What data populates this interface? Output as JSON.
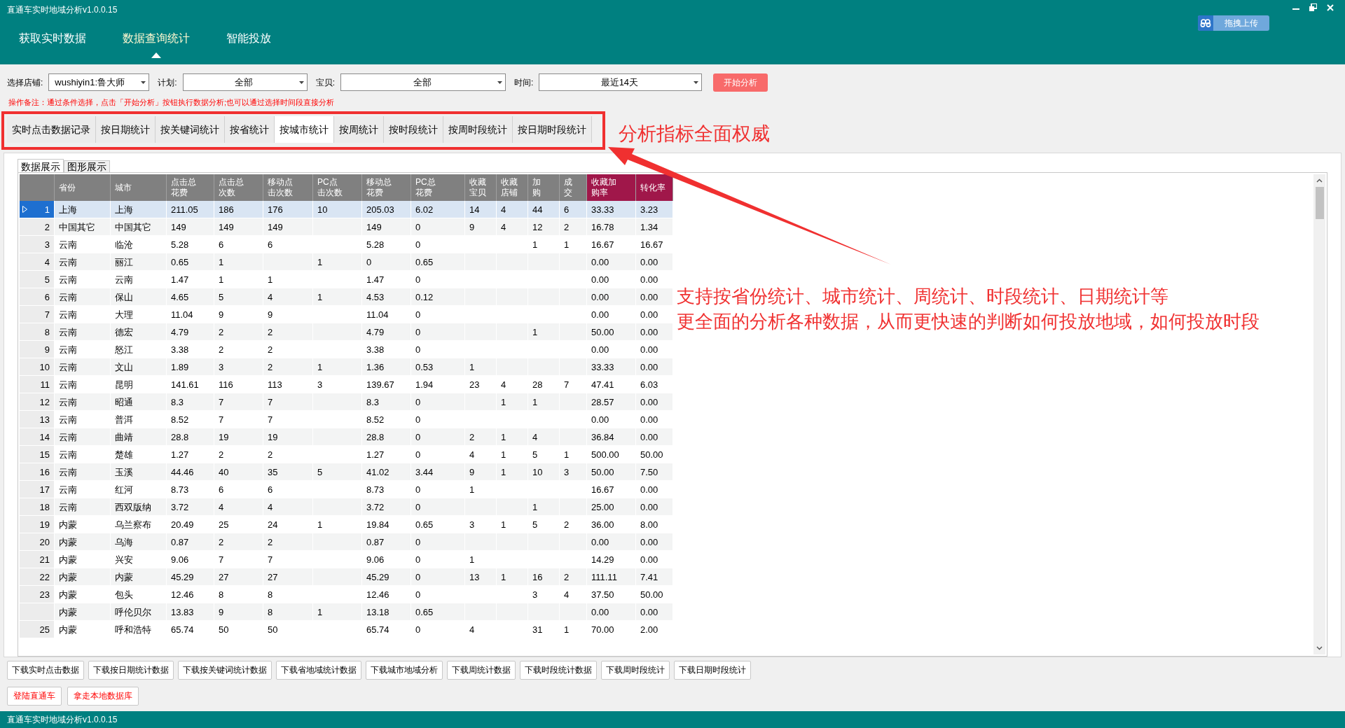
{
  "window": {
    "title": "直通车实时地域分析v1.0.0.15"
  },
  "nav_tabs": [
    {
      "label": "获取实时数据",
      "selected": false
    },
    {
      "label": "数据查询统计",
      "selected": true
    },
    {
      "label": "智能投放",
      "selected": false
    }
  ],
  "upload_button": {
    "label": "拖拽上传"
  },
  "filters": [
    {
      "label": "选择店铺:",
      "value": "wushiyin1:鲁大师"
    },
    {
      "label": "计划:",
      "value": "全部"
    },
    {
      "label": "宝贝:",
      "value": "全部"
    },
    {
      "label": "时间:",
      "value": "最近14天"
    }
  ],
  "analyze_button": {
    "label": "开始分析"
  },
  "note": "操作备注：通过条件选择，点击「开始分析」按钮执行数据分析;也可以通过选择时间段直接分析",
  "tabs": [
    {
      "label": "实时点击数据记录",
      "selected": false
    },
    {
      "label": "按日期统计",
      "selected": false
    },
    {
      "label": "按关键词统计",
      "selected": false
    },
    {
      "label": "按省统计",
      "selected": false
    },
    {
      "label": "按城市统计",
      "selected": true
    },
    {
      "label": "按周统计",
      "selected": false
    },
    {
      "label": "按时段统计",
      "selected": false
    },
    {
      "label": "按周时段统计",
      "selected": false
    },
    {
      "label": "按日期时段统计",
      "selected": false
    }
  ],
  "annotation_title": "分析指标全面权威",
  "annotation_lines": [
    "支持按省份统计、城市统计、周统计、时段统计、日期统计等",
    "更全面的分析各种数据，从而更快速的判断如何投放地域，如何投放时段"
  ],
  "view_tabs": [
    {
      "label": "数据展示",
      "selected": true
    },
    {
      "label": "图形展示",
      "selected": false
    }
  ],
  "table": {
    "columns": [
      {
        "label": "省份",
        "color": "#808080"
      },
      {
        "label": "城市",
        "color": "#808080"
      },
      {
        "label": "点击总花费",
        "color": "#808080"
      },
      {
        "label": "点击总次数",
        "color": "#808080"
      },
      {
        "label": "移动点击次数",
        "color": "#808080"
      },
      {
        "label": "PC点击次数",
        "color": "#808080"
      },
      {
        "label": "移动总花费",
        "color": "#808080"
      },
      {
        "label": "PC总花费",
        "color": "#808080"
      },
      {
        "label": "收藏宝贝",
        "color": "#808080"
      },
      {
        "label": "收藏店铺",
        "color": "#808080"
      },
      {
        "label": "加购",
        "color": "#808080"
      },
      {
        "label": "成交",
        "color": "#808080"
      },
      {
        "label": "收藏加购率",
        "color": "#a0174a"
      },
      {
        "label": "转化率",
        "color": "#a0174a"
      }
    ],
    "rows": [
      {
        "index": "1",
        "selected": true,
        "cells": [
          "上海",
          "上海",
          "211.05",
          "186",
          "176",
          "10",
          "205.03",
          "6.02",
          "14",
          "4",
          "44",
          "6",
          "33.33",
          "3.23"
        ]
      },
      {
        "index": "2",
        "selected": false,
        "cells": [
          "中国其它",
          "中国其它",
          "149",
          "149",
          "149",
          null,
          "149",
          "0",
          "9",
          "4",
          "12",
          "2",
          "16.78",
          "1.34"
        ]
      },
      {
        "index": "3",
        "selected": false,
        "cells": [
          "云南",
          "临沧",
          "5.28",
          "6",
          "6",
          null,
          "5.28",
          "0",
          null,
          null,
          "1",
          "1",
          "16.67",
          "16.67"
        ]
      },
      {
        "index": "4",
        "selected": false,
        "cells": [
          "云南",
          "丽江",
          "0.65",
          "1",
          null,
          "1",
          "0",
          "0.65",
          null,
          null,
          null,
          null,
          "0.00",
          "0.00"
        ]
      },
      {
        "index": "5",
        "selected": false,
        "cells": [
          "云南",
          "云南",
          "1.47",
          "1",
          "1",
          null,
          "1.47",
          "0",
          null,
          null,
          null,
          null,
          "0.00",
          "0.00"
        ]
      },
      {
        "index": "6",
        "selected": false,
        "cells": [
          "云南",
          "保山",
          "4.65",
          "5",
          "4",
          "1",
          "4.53",
          "0.12",
          null,
          null,
          null,
          null,
          "0.00",
          "0.00"
        ]
      },
      {
        "index": "7",
        "selected": false,
        "cells": [
          "云南",
          "大理",
          "11.04",
          "9",
          "9",
          null,
          "11.04",
          "0",
          null,
          null,
          null,
          null,
          "0.00",
          "0.00"
        ]
      },
      {
        "index": "8",
        "selected": false,
        "cells": [
          "云南",
          "德宏",
          "4.79",
          "2",
          "2",
          null,
          "4.79",
          "0",
          null,
          null,
          "1",
          null,
          "50.00",
          "0.00"
        ]
      },
      {
        "index": "9",
        "selected": false,
        "cells": [
          "云南",
          "怒江",
          "3.38",
          "2",
          "2",
          null,
          "3.38",
          "0",
          null,
          null,
          null,
          null,
          "0.00",
          "0.00"
        ]
      },
      {
        "index": "10",
        "selected": false,
        "cells": [
          "云南",
          "文山",
          "1.89",
          "3",
          "2",
          "1",
          "1.36",
          "0.53",
          "1",
          null,
          null,
          null,
          "33.33",
          "0.00"
        ]
      },
      {
        "index": "11",
        "selected": false,
        "cells": [
          "云南",
          "昆明",
          "141.61",
          "116",
          "113",
          "3",
          "139.67",
          "1.94",
          "23",
          "4",
          "28",
          "7",
          "47.41",
          "6.03"
        ]
      },
      {
        "index": "12",
        "selected": false,
        "cells": [
          "云南",
          "昭通",
          "8.3",
          "7",
          "7",
          null,
          "8.3",
          "0",
          null,
          "1",
          "1",
          null,
          "28.57",
          "0.00"
        ]
      },
      {
        "index": "13",
        "selected": false,
        "cells": [
          "云南",
          "普洱",
          "8.52",
          "7",
          "7",
          null,
          "8.52",
          "0",
          null,
          null,
          null,
          null,
          "0.00",
          "0.00"
        ]
      },
      {
        "index": "14",
        "selected": false,
        "cells": [
          "云南",
          "曲靖",
          "28.8",
          "19",
          "19",
          null,
          "28.8",
          "0",
          "2",
          "1",
          "4",
          null,
          "36.84",
          "0.00"
        ]
      },
      {
        "index": "15",
        "selected": false,
        "cells": [
          "云南",
          "楚雄",
          "1.27",
          "2",
          "2",
          null,
          "1.27",
          "0",
          "4",
          "1",
          "5",
          "1",
          "500.00",
          "50.00"
        ]
      },
      {
        "index": "16",
        "selected": false,
        "cells": [
          "云南",
          "玉溪",
          "44.46",
          "40",
          "35",
          "5",
          "41.02",
          "3.44",
          "9",
          "1",
          "10",
          "3",
          "50.00",
          "7.50"
        ]
      },
      {
        "index": "17",
        "selected": false,
        "cells": [
          "云南",
          "红河",
          "8.73",
          "6",
          "6",
          null,
          "8.73",
          "0",
          "1",
          null,
          null,
          null,
          "16.67",
          "0.00"
        ]
      },
      {
        "index": "18",
        "selected": false,
        "cells": [
          "云南",
          "西双版纳",
          "3.72",
          "4",
          "4",
          null,
          "3.72",
          "0",
          null,
          null,
          "1",
          null,
          "25.00",
          "0.00"
        ]
      },
      {
        "index": "19",
        "selected": false,
        "cells": [
          "内蒙",
          "乌兰察布",
          "20.49",
          "25",
          "24",
          "1",
          "19.84",
          "0.65",
          "3",
          "1",
          "5",
          "2",
          "36.00",
          "8.00"
        ]
      },
      {
        "index": "20",
        "selected": false,
        "cells": [
          "内蒙",
          "乌海",
          "0.87",
          "2",
          "2",
          null,
          "0.87",
          "0",
          null,
          null,
          null,
          null,
          "0.00",
          "0.00"
        ]
      },
      {
        "index": "21",
        "selected": false,
        "cells": [
          "内蒙",
          "兴安",
          "9.06",
          "7",
          "7",
          null,
          "9.06",
          "0",
          "1",
          null,
          null,
          null,
          "14.29",
          "0.00"
        ]
      },
      {
        "index": "22",
        "selected": false,
        "cells": [
          "内蒙",
          "内蒙",
          "45.29",
          "27",
          "27",
          null,
          "45.29",
          "0",
          "13",
          "1",
          "16",
          "2",
          "111.11",
          "7.41"
        ]
      },
      {
        "index": "23",
        "selected": false,
        "cells": [
          "内蒙",
          "包头",
          "12.46",
          "8",
          "8",
          null,
          "12.46",
          "0",
          null,
          null,
          "3",
          "4",
          "37.50",
          "50.00"
        ]
      },
      {
        "selected": false,
        "cells": [
          "内蒙",
          "呼伦贝尔",
          "13.83",
          "9",
          "8",
          "1",
          "13.18",
          "0.65",
          null,
          null,
          null,
          null,
          "0.00",
          "0.00"
        ]
      },
      {
        "index": "25",
        "selected": false,
        "cells": [
          "内蒙",
          "呼和浩特",
          "65.74",
          "50",
          "50",
          null,
          "65.74",
          "0",
          "4",
          null,
          "31",
          "1",
          "70.00",
          "2.00"
        ]
      }
    ]
  },
  "download_buttons": [
    "下载实时点击数据",
    "下载按日期统计数据",
    "下载按关键词统计数据",
    "下载省地域统计数据",
    "下载城市地域分析",
    "下载周统计数据",
    "下载时段统计数据",
    "下载周时段统计",
    "下载日期时段统计"
  ],
  "action_buttons": [
    "登陆直通车",
    "拿走本地数据库"
  ],
  "status_bar": "直通车实时地域分析v1.0.0.15"
}
